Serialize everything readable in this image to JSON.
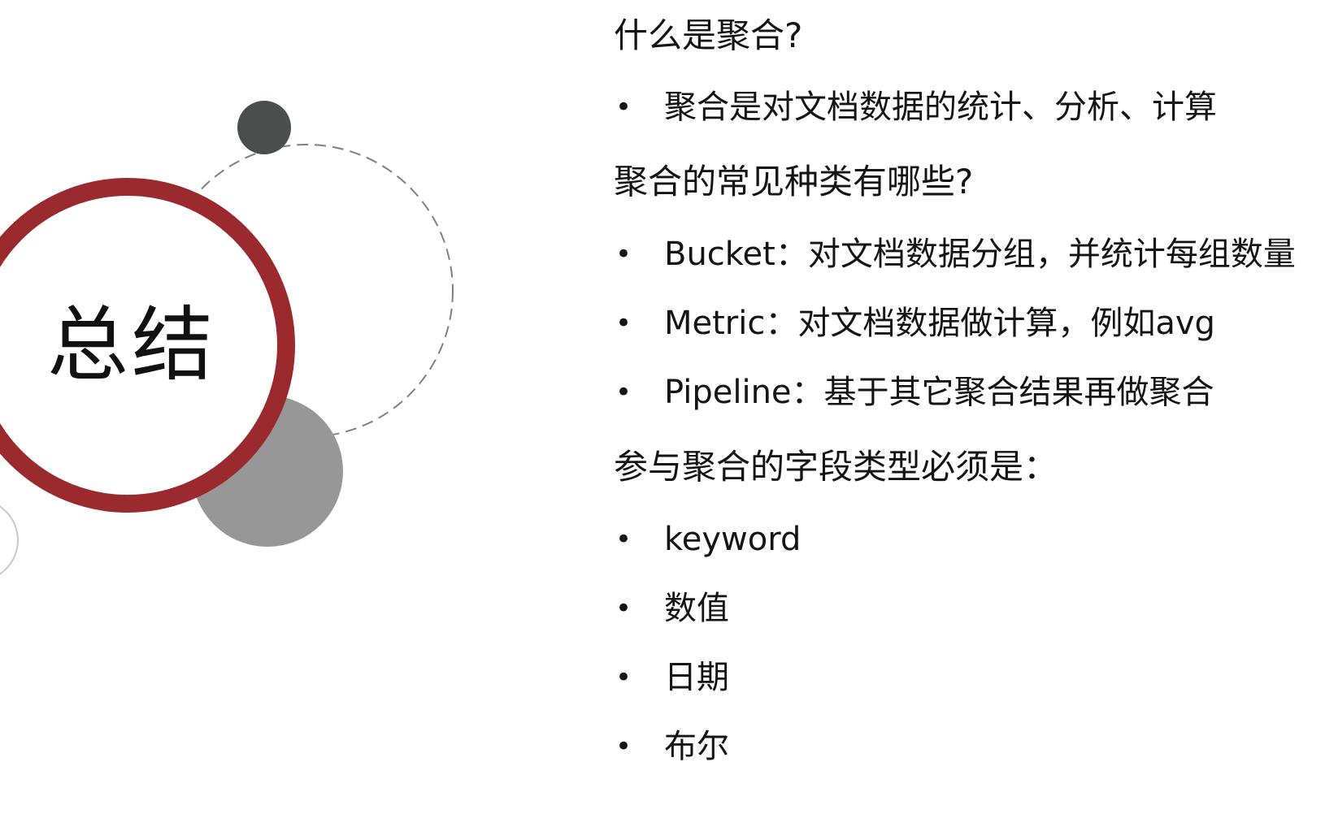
{
  "slide": {
    "title": "总结",
    "sections": [
      {
        "heading": "什么是聚合?",
        "items": [
          "聚合是对文档数据的统计、分析、计算"
        ]
      },
      {
        "heading": "聚合的常见种类有哪些?",
        "items": [
          "Bucket：对文档数据分组，并统计每组数量",
          "Metric：对文档数据做计算，例如avg",
          "Pipeline：基于其它聚合结果再做聚合"
        ]
      },
      {
        "heading": "参与聚合的字段类型必须是：",
        "items": [
          "keyword",
          "数值",
          "日期",
          "布尔"
        ]
      }
    ],
    "bullet_symbol": "•"
  },
  "colors": {
    "ring": "#9b2a2f",
    "dark_circle": "#4a4f4e",
    "gray_circle": "#979797",
    "dashed_ring": "#808080",
    "thin_ring": "#c8c8c8"
  }
}
